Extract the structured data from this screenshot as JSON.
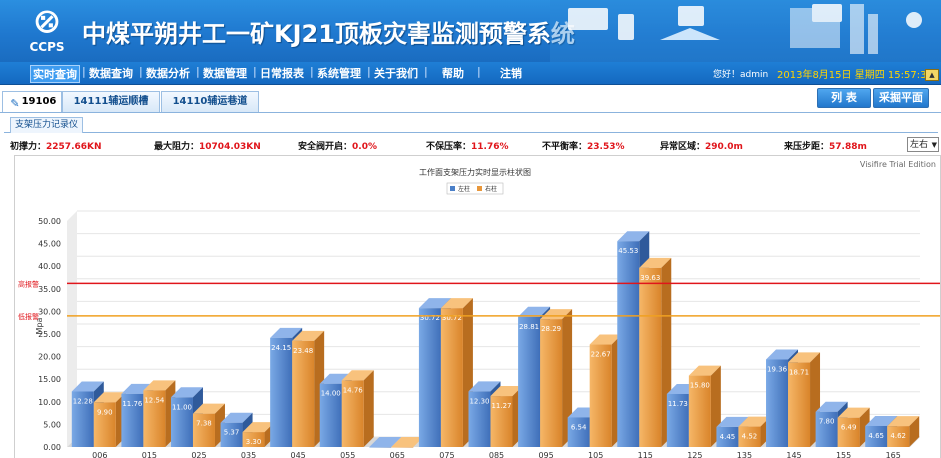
{
  "header": {
    "logo_text": "CCPS",
    "title": "中煤平朔井工一矿KJ21顶板灾害监测预警系统"
  },
  "nav": {
    "items": [
      "实时查询",
      "数据查询",
      "数据分析",
      "数据管理",
      "日常报表",
      "系统管理",
      "关于我们",
      "帮助",
      "注销"
    ],
    "welcome": "您好！admin",
    "datetime": "2013年8月15日  星期四  15:57:37"
  },
  "tabs": [
    "19106",
    "14111辅运顺槽",
    "14110辅运巷道"
  ],
  "buttons": {
    "list": "列 表",
    "collect": "采掘平面"
  },
  "subtab": "支架压力记录仪",
  "stats": [
    {
      "label": "初撑力：",
      "value": "2257.66KN"
    },
    {
      "label": "最大阻力：",
      "value": "10704.03KN"
    },
    {
      "label": "安全阀开启：",
      "value": "0.0%"
    },
    {
      "label": "不保压率：",
      "value": "11.76%"
    },
    {
      "label": "不平衡率：",
      "value": "23.53%"
    },
    {
      "label": "异常区域：",
      "value": "290.0m"
    },
    {
      "label": "来压步距：",
      "value": "57.88m"
    }
  ],
  "side_select": {
    "value": "左右"
  },
  "watermark": "Visifire Trial Edition",
  "colors": {
    "left": "#4a7fc8",
    "right": "#e8973b",
    "high": "#e0151b",
    "low": "#f0a020"
  },
  "chart_data": {
    "type": "bar",
    "title": "工作面支架压力实时显示柱状图",
    "ylabel": "Mpa",
    "ylim": [
      0,
      50
    ],
    "yticks": [
      "0.00",
      "5.00",
      "10.00",
      "15.00",
      "20.00",
      "25.00",
      "30.00",
      "35.00",
      "40.00",
      "45.00",
      "50.00"
    ],
    "categories": [
      "006",
      "015",
      "025",
      "035",
      "045",
      "055",
      "065",
      "075",
      "085",
      "095",
      "105",
      "115",
      "125",
      "135",
      "145",
      "155",
      "165"
    ],
    "series": [
      {
        "name": "左柱",
        "values": [
          12.28,
          11.76,
          11.0,
          5.37,
          24.15,
          14.0,
          0.0,
          30.72,
          12.3,
          28.81,
          6.54,
          45.53,
          11.73,
          4.45,
          19.36,
          7.8,
          4.65
        ]
      },
      {
        "name": "右柱",
        "values": [
          9.9,
          12.54,
          7.38,
          3.3,
          23.48,
          14.76,
          0.0,
          30.72,
          11.27,
          28.29,
          22.67,
          39.63,
          15.8,
          4.52,
          18.71,
          6.49,
          4.62
        ]
      }
    ],
    "annotations": [
      {
        "label": "高报警",
        "value": 34.0
      },
      {
        "label": "低报警",
        "value": 26.8
      }
    ],
    "legend": "top"
  }
}
